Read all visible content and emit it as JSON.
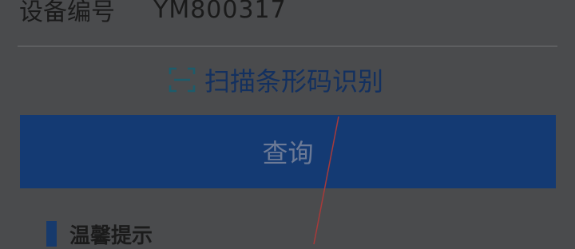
{
  "device": {
    "label": "设备编号",
    "value": "YM800317"
  },
  "scan": {
    "icon": "barcode-scan-icon",
    "label": "扫描条形码识别"
  },
  "query": {
    "label": "查询"
  },
  "tips": {
    "title": "温馨提示"
  },
  "colors": {
    "primary": "#143a73",
    "link": "#13305f",
    "overlay_bg": "#4a4b4d",
    "annotation_line": "#c0392b"
  }
}
